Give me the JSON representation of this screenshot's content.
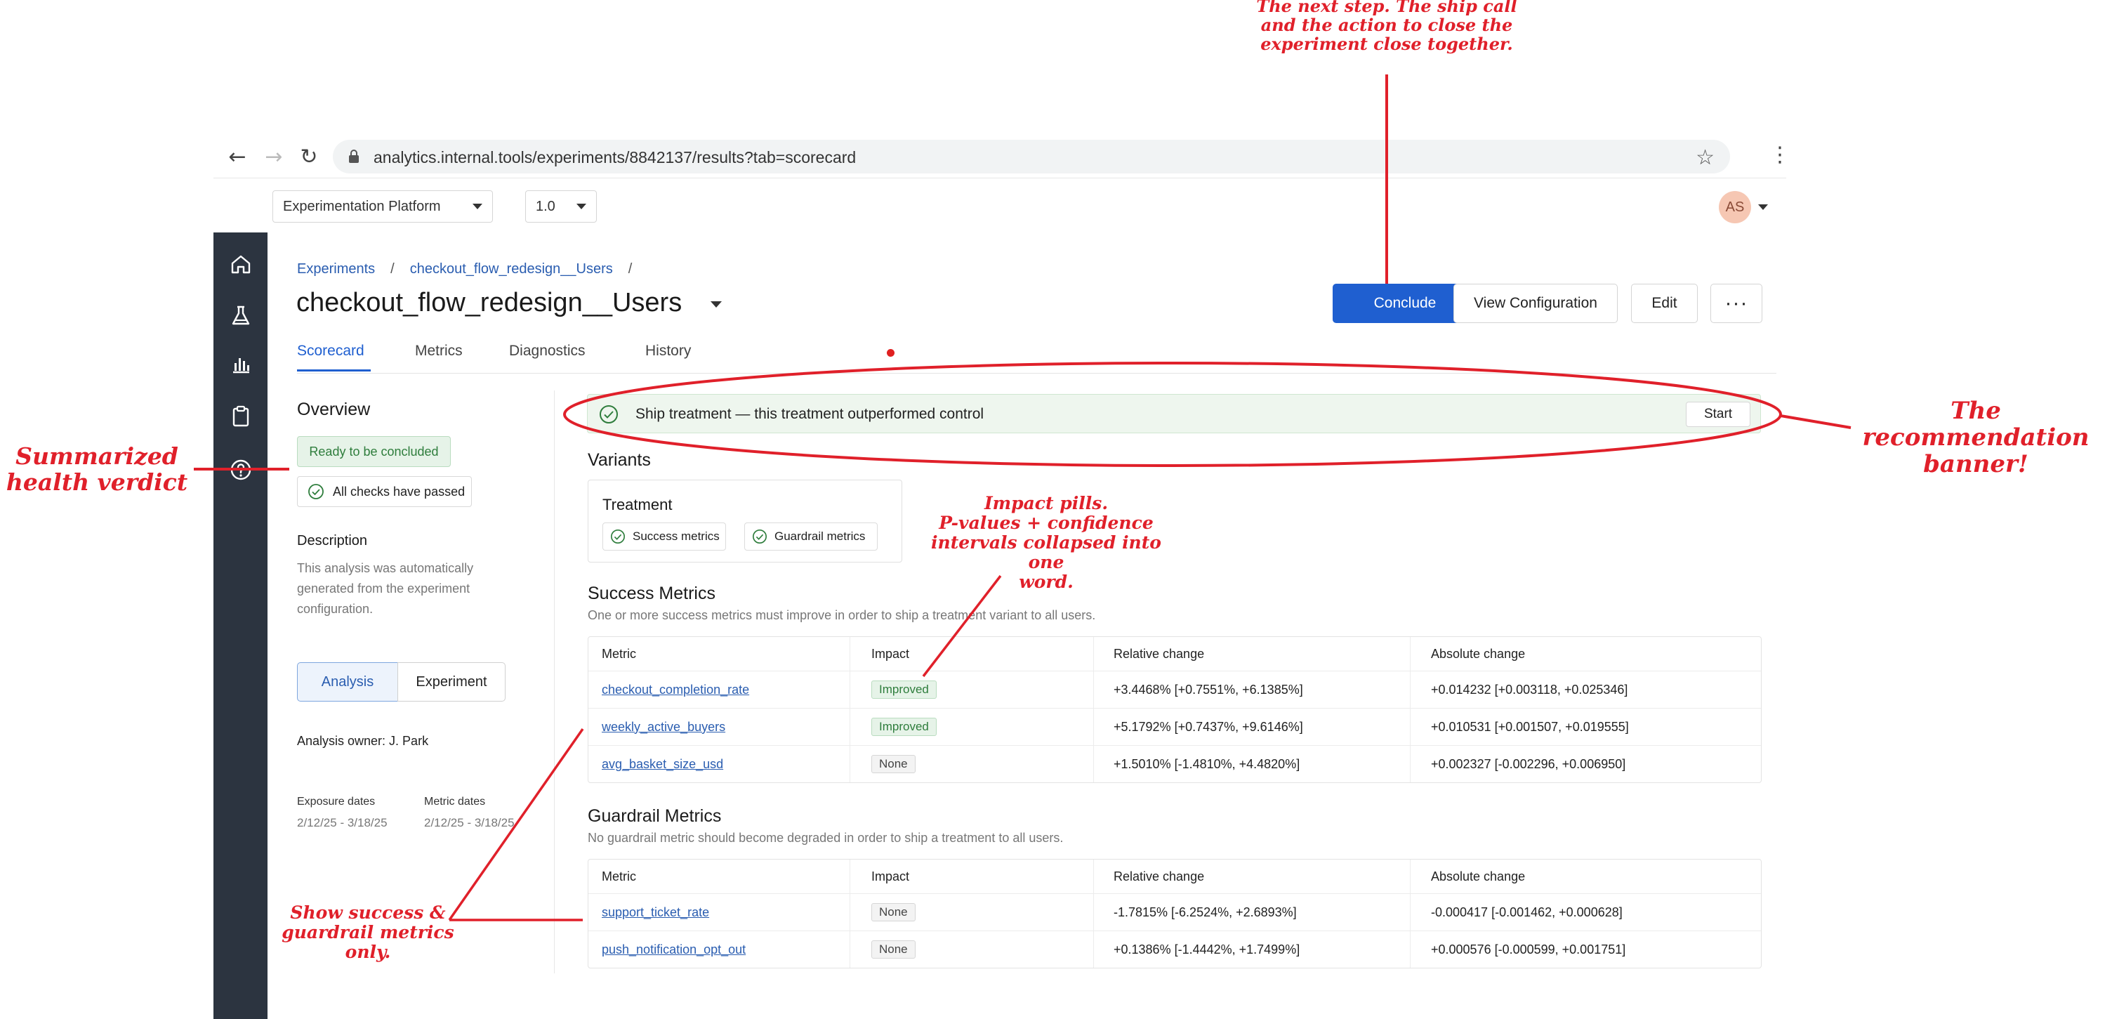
{
  "browser": {
    "url": "analytics.internal.tools/experiments/8842137/results?tab=scorecard",
    "icons": [
      "back-arrow-icon",
      "forward-arrow-icon",
      "reload-icon",
      "lock-icon",
      "star-icon",
      "kebab-icon"
    ]
  },
  "topbar": {
    "platform_select": "Experimentation Platform",
    "version_select": "1.0",
    "avatar_initials": "AS"
  },
  "sidebar": {
    "icons": [
      "home-icon",
      "flask-icon",
      "bar-chart-icon",
      "clipboard-icon",
      "help-icon"
    ],
    "background": "#2c3440"
  },
  "header": {
    "breadcrumb": {
      "root": "Experiments",
      "sep": "/",
      "experiment": "checkout_flow_redesign__Users"
    },
    "title": "checkout_flow_redesign__Users",
    "buttons": {
      "conclude": "Conclude",
      "view_config": "View Configuration",
      "edit": "Edit",
      "more": "···"
    },
    "tabs": [
      "Scorecard",
      "Metrics",
      "Diagnostics",
      "History"
    ]
  },
  "overview": {
    "title": "Overview",
    "status_badge": "Ready to be concluded",
    "checks": "All checks have passed",
    "description_title": "Description",
    "description_text": "This analysis was automatically generated from the experiment configuration.",
    "segments": [
      "Analysis",
      "Experiment"
    ],
    "owner": "Analysis owner: J. Park",
    "exposure_label": "Exposure dates",
    "exposure_value": "2/12/25 - 3/18/25",
    "metric_label": "Metric dates",
    "metric_value": "2/12/25 - 3/18/25"
  },
  "banner": {
    "text": "Ship treatment — this treatment outperformed control",
    "button": "Start"
  },
  "variants": {
    "title": "Variants",
    "name": "Treatment",
    "pills": [
      "Success metrics",
      "Guardrail metrics"
    ]
  },
  "success_metrics": {
    "title": "Success Metrics",
    "subtitle": "One or more success metrics must improve in order to ship a treatment variant to all users.",
    "columns": [
      "Metric",
      "Impact",
      "Relative change",
      "Absolute change"
    ],
    "rows": [
      {
        "metric": "checkout_completion_rate",
        "impact": "Improved",
        "relative": "+3.4468%  [+0.7551%, +6.1385%]",
        "absolute": "+0.014232  [+0.003118, +0.025346]"
      },
      {
        "metric": "weekly_active_buyers",
        "impact": "Improved",
        "relative": "+5.1792%  [+0.7437%, +9.6146%]",
        "absolute": "+0.010531  [+0.001507, +0.019555]"
      },
      {
        "metric": "avg_basket_size_usd",
        "impact": "None",
        "relative": "+1.5010%  [-1.4810%, +4.4820%]",
        "absolute": "+0.002327  [-0.002296, +0.006950]"
      }
    ]
  },
  "guardrail_metrics": {
    "title": "Guardrail Metrics",
    "subtitle": "No guardrail metric should become degraded in order to ship a treatment to all users.",
    "columns": [
      "Metric",
      "Impact",
      "Relative change",
      "Absolute change"
    ],
    "rows": [
      {
        "metric": "support_ticket_rate",
        "impact": "None",
        "relative": "-1.7815%  [-6.2524%, +2.6893%]",
        "absolute": "-0.000417  [-0.001462, +0.000628]"
      },
      {
        "metric": "push_notification_opt_out",
        "impact": "None",
        "relative": "+0.1386%  [-1.4442%, +1.7499%]",
        "absolute": "+0.000576  [-0.000599, +0.001751]"
      }
    ]
  },
  "annotations": {
    "next_step": [
      "The next step. The ship call",
      "and the action to close the",
      "experiment close together."
    ],
    "recommendation": [
      "The recommendation",
      "banner!"
    ],
    "health": [
      "Summarized",
      "health verdict"
    ],
    "impact_pills": [
      "Impact pills.",
      "P-values + confidence",
      "intervals collapsed into one",
      "word."
    ],
    "show_metrics": [
      "Show success &",
      "guardrail metrics",
      "only."
    ],
    "color": "#e0202a"
  },
  "colors": {
    "primary": "#1f5fd0",
    "success": "#2e7d3c",
    "success_bg": "#e6f3e8",
    "alert_dot": "#e02020"
  }
}
